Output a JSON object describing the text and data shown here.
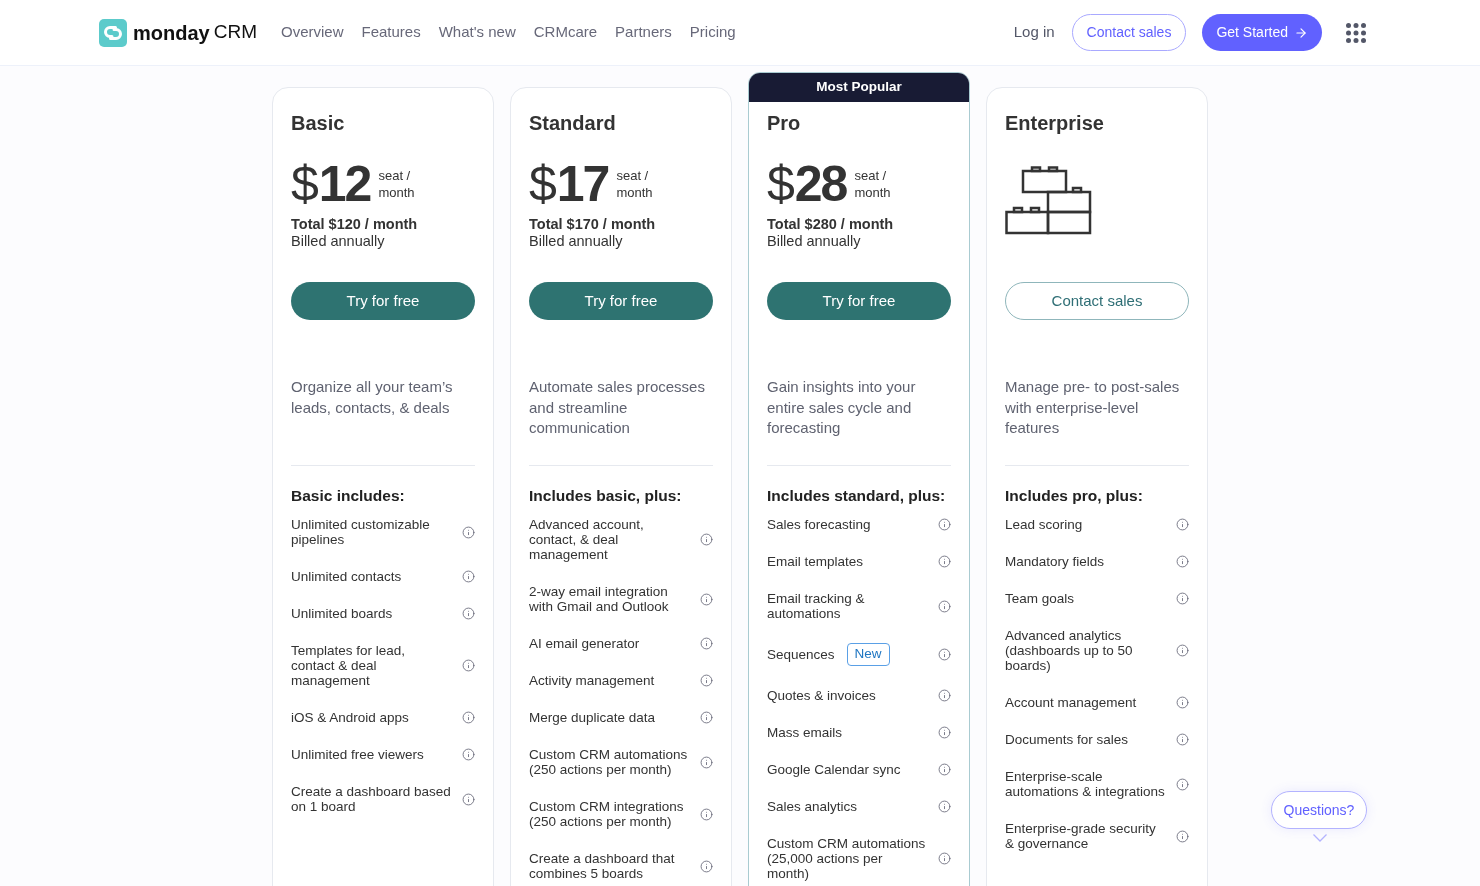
{
  "header": {
    "logo": {
      "name": "monday",
      "suffix": "CRM"
    },
    "nav": [
      "Overview",
      "Features",
      "What's new",
      "CRMcare",
      "Partners",
      "Pricing"
    ],
    "login": "Log in",
    "contact_sales": "Contact sales",
    "get_started": "Get Started"
  },
  "plans": [
    {
      "name": "Basic",
      "highlighted": false,
      "kind": "priced",
      "price": {
        "currency": "$",
        "amount": "12",
        "unit": "seat / month"
      },
      "total": "Total $120 / month",
      "billing": "Billed annually",
      "cta": {
        "label": "Try for free",
        "kind": "filled"
      },
      "description": "Organize all your team’s leads, contacts, & deals",
      "features_heading": "Basic includes:",
      "features": [
        {
          "text": "Unlimited customizable pipelines"
        },
        {
          "text": "Unlimited contacts"
        },
        {
          "text": "Unlimited boards"
        },
        {
          "text": "Templates for lead, contact & deal management"
        },
        {
          "text": "iOS & Android apps"
        },
        {
          "text": "Unlimited free viewers"
        },
        {
          "text": "Create a dashboard based on 1 board"
        }
      ]
    },
    {
      "name": "Standard",
      "highlighted": false,
      "kind": "priced",
      "price": {
        "currency": "$",
        "amount": "17",
        "unit": "seat / month"
      },
      "total": "Total $170 / month",
      "billing": "Billed annually",
      "cta": {
        "label": "Try for free",
        "kind": "filled"
      },
      "description": "Automate sales processes and streamline communication",
      "features_heading": "Includes basic, plus:",
      "features": [
        {
          "text": "Advanced account, contact, & deal management"
        },
        {
          "text": "2-way email integration with Gmail and Outlook"
        },
        {
          "text": "AI email generator"
        },
        {
          "text": "Activity management"
        },
        {
          "text": "Merge duplicate data"
        },
        {
          "text": "Custom CRM automations (250 actions per month)"
        },
        {
          "text": "Custom CRM integrations (250 actions per month)"
        },
        {
          "text": "Create a dashboard that combines 5 boards"
        }
      ]
    },
    {
      "name": "Pro",
      "banner": "Most Popular",
      "highlighted": true,
      "kind": "priced",
      "price": {
        "currency": "$",
        "amount": "28",
        "unit": "seat / month"
      },
      "total": "Total $280 / month",
      "billing": "Billed annually",
      "cta": {
        "label": "Try for free",
        "kind": "filled"
      },
      "description": "Gain insights into your entire sales cycle and forecasting",
      "features_heading": "Includes standard, plus:",
      "features": [
        {
          "text": "Sales forecasting"
        },
        {
          "text": "Email templates"
        },
        {
          "text": "Email tracking & automations"
        },
        {
          "text": "Sequences",
          "badge": "New"
        },
        {
          "text": "Quotes & invoices"
        },
        {
          "text": "Mass emails"
        },
        {
          "text": "Google Calendar sync"
        },
        {
          "text": "Sales analytics"
        },
        {
          "text": "Custom CRM automations (25,000 actions per month)"
        }
      ]
    },
    {
      "name": "Enterprise",
      "highlighted": false,
      "kind": "custom",
      "cta": {
        "label": "Contact sales",
        "kind": "outline"
      },
      "description": "Manage pre- to post-sales with enterprise-level features",
      "features_heading": "Includes pro, plus:",
      "features": [
        {
          "text": "Lead scoring"
        },
        {
          "text": "Mandatory fields"
        },
        {
          "text": "Team goals"
        },
        {
          "text": "Advanced analytics (dashboards up to 50 boards)"
        },
        {
          "text": "Account management"
        },
        {
          "text": "Documents for sales"
        },
        {
          "text": "Enterprise-scale automations & integrations"
        },
        {
          "text": "Enterprise-grade security & governance"
        }
      ]
    }
  ],
  "help_bubble": "Questions?"
}
